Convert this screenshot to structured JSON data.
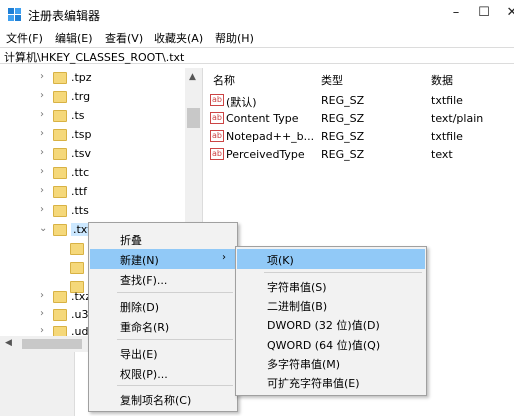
{
  "window": {
    "title": "注册表编辑器",
    "minimize": "–",
    "maximize": "☐",
    "close": "✕"
  },
  "menu": {
    "items": [
      "文件(F)",
      "编辑(E)",
      "查看(V)",
      "收藏夹(A)",
      "帮助(H)"
    ]
  },
  "address": {
    "path": "计算机\\HKEY_CLASSES_ROOT\\.txt"
  },
  "tree": {
    "items": [
      {
        "label": ".tpz",
        "expanded": false
      },
      {
        "label": ".trg",
        "expanded": false
      },
      {
        "label": ".ts",
        "expanded": false
      },
      {
        "label": ".tsp",
        "expanded": false
      },
      {
        "label": ".tsv",
        "expanded": false
      },
      {
        "label": ".ttc",
        "expanded": false
      },
      {
        "label": ".ttf",
        "expanded": false
      },
      {
        "label": ".tts",
        "expanded": false
      },
      {
        "label": ".txt",
        "expanded": true,
        "selected": true
      },
      {
        "label": "",
        "child": true
      },
      {
        "label": "",
        "child": true
      },
      {
        "label": "",
        "child": true
      },
      {
        "label": ".txz",
        "expanded": false
      },
      {
        "label": ".u3",
        "expanded": false
      },
      {
        "label": ".ud",
        "expanded": false
      }
    ]
  },
  "values": {
    "headers": {
      "name": "名称",
      "type": "类型",
      "data": "数据"
    },
    "rows": [
      {
        "name": "(默认)",
        "type": "REG_SZ",
        "data": "txtfile"
      },
      {
        "name": "Content Type",
        "type": "REG_SZ",
        "data": "text/plain"
      },
      {
        "name": "Notepad++_b...",
        "type": "REG_SZ",
        "data": "txtfile"
      },
      {
        "name": "PerceivedType",
        "type": "REG_SZ",
        "data": "text"
      }
    ]
  },
  "context_menu": {
    "items": [
      "折叠",
      "新建(N)",
      "查找(F)...",
      "删除(D)",
      "重命名(R)",
      "导出(E)",
      "权限(P)...",
      "复制项名称(C)"
    ],
    "highlighted": "新建(N)"
  },
  "submenu": {
    "items": [
      "项(K)",
      "字符串值(S)",
      "二进制值(B)",
      "DWORD (32 位)值(D)",
      "QWORD (64 位)值(Q)",
      "多字符串值(M)",
      "可扩充字符串值(E)"
    ],
    "highlighted": "项(K)"
  },
  "colors": {
    "highlight": "#91c9f7",
    "selection": "#cce8ff",
    "folder": "#f5d87a",
    "menu_bg": "#f2f2f2"
  }
}
